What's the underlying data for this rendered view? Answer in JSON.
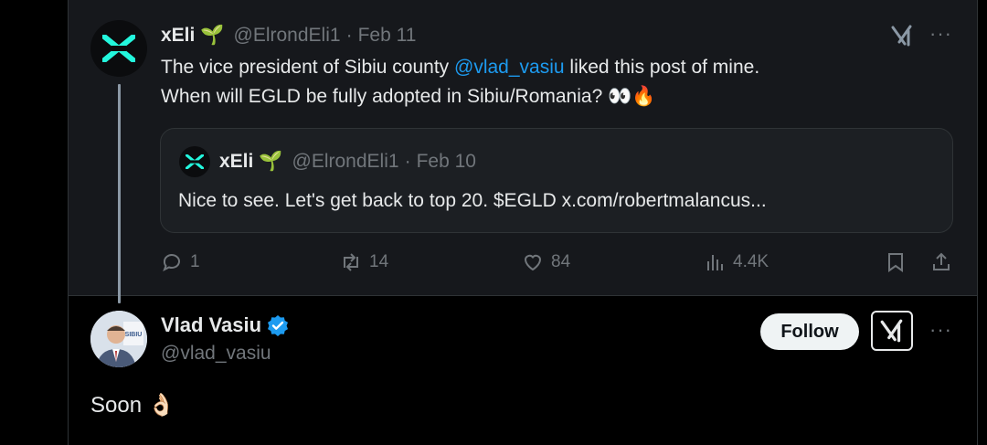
{
  "original_post": {
    "author_name": "xEli",
    "author_emoji": "🌱",
    "handle": "@ElrondEli1",
    "separator": "·",
    "date": "Feb 11",
    "text_line1_before": "The vice president of Sibiu county ",
    "mention": "@vlad_vasiu",
    "text_line1_after": " liked this post of mine.",
    "text_line2": "When will EGLD be fully adopted in Sibiu/Romania? 👀🔥",
    "quote": {
      "author_name": "xEli",
      "author_emoji": "🌱",
      "handle": "@ElrondEli1",
      "separator": "·",
      "date": "Feb 10",
      "text": "Nice to see. Let's get back to top 20. $EGLD x.com/robertmalancus..."
    },
    "actions": {
      "replies": "1",
      "reposts": "14",
      "likes": "84",
      "views": "4.4K"
    },
    "more_label": "···"
  },
  "reply": {
    "author_name": "Vlad Vasiu",
    "handle": "@vlad_vasiu",
    "follow_label": "Follow",
    "more_label": "···",
    "text": "Soon 👌🏻",
    "avatar_text": "SIBIU"
  },
  "colors": {
    "accent": "#1d9bf0",
    "muted": "#71767b",
    "text": "#e7e9ea",
    "background": "#000000",
    "card": "#16181c"
  },
  "icons": [
    "multiversx-logo",
    "grok-icon",
    "more-icon",
    "reply-icon",
    "repost-icon",
    "like-icon",
    "views-icon",
    "bookmark-icon",
    "share-icon",
    "verified-badge"
  ]
}
